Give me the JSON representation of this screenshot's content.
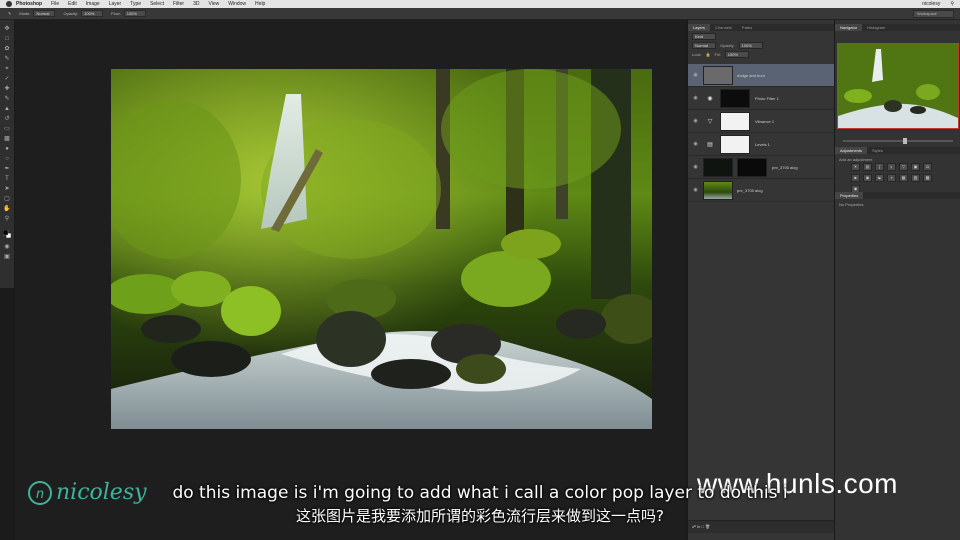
{
  "menubar": {
    "app": "Photoshop",
    "items": [
      "File",
      "Edit",
      "Image",
      "Layer",
      "Type",
      "Select",
      "Filter",
      "3D",
      "View",
      "Window",
      "Help"
    ],
    "user": "nicolesy"
  },
  "options_bar": {
    "mode_label": "Mode:",
    "mode_value": "Normal",
    "opacity_label": "Opacity:",
    "opacity_value": "100%",
    "flow_label": "Flow:",
    "flow_value": "100%",
    "workspace": "Workspace"
  },
  "layers_panel": {
    "tabs": [
      "Layers",
      "Channels",
      "Paths"
    ],
    "kind_filter": "Kind",
    "blend_mode": "Normal",
    "opacity_label": "Opacity:",
    "opacity_value": "100%",
    "lock_label": "Lock:",
    "fill_label": "Fill:",
    "fill_value": "100%",
    "layers": [
      {
        "name": "dodge and burn",
        "type": "pixel",
        "selected": true
      },
      {
        "name": "Photo Filter 1",
        "type": "adjustment",
        "selected": false
      },
      {
        "name": "Vibrance 1",
        "type": "adjustment",
        "selected": false
      },
      {
        "name": "Levels 1",
        "type": "adjustment",
        "selected": false
      },
      {
        "name": "pnr_3705 alog",
        "type": "pixel",
        "selected": false
      },
      {
        "name": "pnr_3705 alog",
        "type": "pixel",
        "selected": false
      }
    ]
  },
  "right_column": {
    "tabs": [
      "Navigator",
      "Histogram"
    ],
    "adjustments_tabs": [
      "Adjustments",
      "Styles"
    ],
    "adjustments_title": "Add an adjustment",
    "properties_tab": "Properties",
    "properties_title": "No Properties",
    "colors": {
      "nav_frame": "#c23a2e"
    }
  },
  "overlay": {
    "watermark_letter": "n",
    "watermark_text": "nicolesy",
    "site": "www.hunls.com",
    "subtitle_en": "do this image is i'm going to add what i call a color pop layer to do this i",
    "subtitle_zh": "这张图片是我要添加所谓的彩色流行层来做到这一点吗?"
  }
}
